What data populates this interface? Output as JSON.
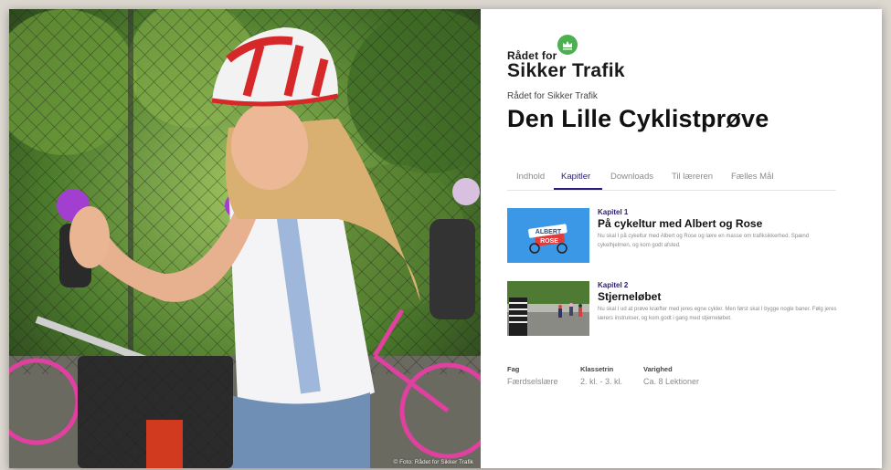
{
  "photo": {
    "credit": "© Foto: Rådet for Sikker Trafik"
  },
  "logo": {
    "line1": "Rådet for",
    "line2": "Sikker Trafik",
    "crest_icon": "crown-icon",
    "crest_color": "#4caf50"
  },
  "publisher": "Rådet for Sikker Trafik",
  "title": "Den Lille Cyklistprøve",
  "tabs": [
    {
      "label": "Indhold",
      "active": false
    },
    {
      "label": "Kapitler",
      "active": true
    },
    {
      "label": "Downloads",
      "active": false
    },
    {
      "label": "Til læreren",
      "active": false
    },
    {
      "label": "Fælles Mål",
      "active": false
    }
  ],
  "accent_color": "#2a1d7a",
  "chapters": [
    {
      "kicker": "Kapitel 1",
      "title": "På cykeltur med Albert og Rose",
      "description": "Nu skal I på cykeltur med Albert og Rose og lære en masse om trafiksikkerhed. Spænd cykelhjelmen, og kom godt afsted.",
      "thumb_text_1": "ALBERT",
      "thumb_text_2": "ROSE"
    },
    {
      "kicker": "Kapitel 2",
      "title": "Stjerneløbet",
      "description": "Nu skal I ud at prøve kræfter med jeres egne cykler. Men først skal I bygge nogle baner. Følg jeres lærers instrukser, og kom godt i gang med stjerneløbet."
    }
  ],
  "meta": [
    {
      "label": "Fag",
      "value": "Færdselslære"
    },
    {
      "label": "Klassetrin",
      "value": "2. kl. - 3. kl."
    },
    {
      "label": "Varighed",
      "value": "Ca. 8 Lektioner"
    }
  ]
}
